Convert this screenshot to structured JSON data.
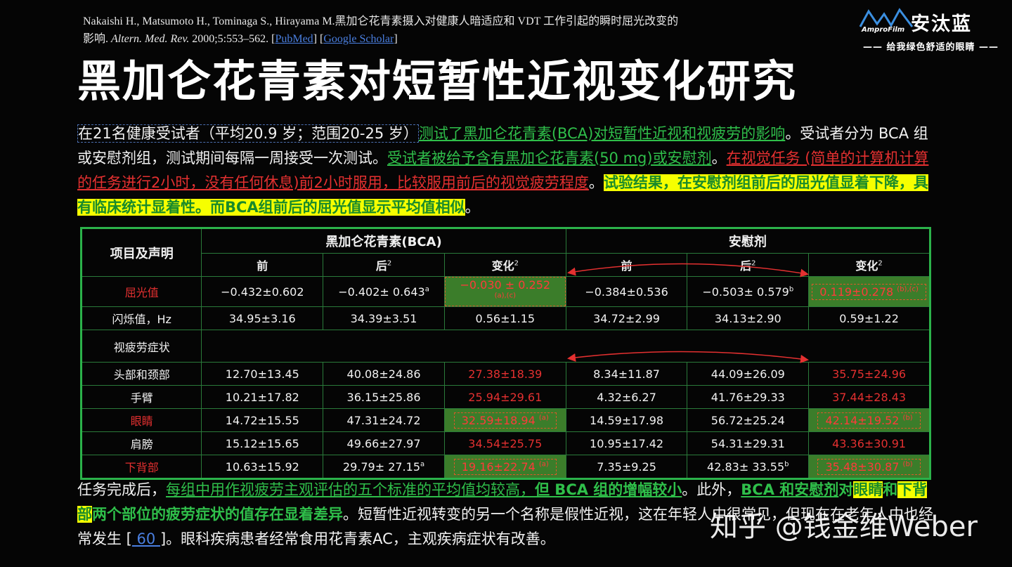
{
  "citation": {
    "line1": "Nakaishi H., Matsumoto H., Tominaga S., Hirayama M.黑加仑花青素摄入对健康人暗适应和 VDT 工作引起的瞬时屈光改变的",
    "line2_pre": "影响. ",
    "journal": "Altern. Med. Rev.",
    "line2_post": " 2000;5:553–562. [",
    "pubmed": "PubMed",
    "mid": "] [",
    "scholar": "Google Scholar",
    "end": "]"
  },
  "logo": {
    "name": "安汰蓝",
    "brand": "AmproFilm",
    "slogan": "—— 给我绿色舒适的眼睛 ——"
  },
  "title": "黑加仑花青素对短暂性近视变化研究",
  "intro": {
    "p1": "在21名健康受试者（平均20.9 岁；范围20-25 岁）",
    "p2": "测试了黑加仑花青素(BCA)对短暂性近视和视疲劳的影响",
    "p3": "。受试者",
    "p4": "分为 BCA 组或安慰剂组，测试期间每隔一周接受一次测试。",
    "p5": "受试者被给予含有黑加仑花青素(50 mg)或安慰剂",
    "p6": "。",
    "p7": "在视觉任务 (简单的计算机计算的任务进行2小时，没有任何休息)前2小时服用，比较服用前后的视觉疲劳程度",
    "p8": "。",
    "p9": "试验结果，在安慰剂组前后的屈光值显着下降，具有临床统计显着性。而BCA组前后的屈光值显示平均值相似",
    "p10": "。"
  },
  "table": {
    "corner": "项目及声明",
    "group1": "黑加仑花青素(BCA)",
    "group2": "安慰剂",
    "sub_before": "前",
    "sub_after": "后",
    "sub_change": "变化",
    "sup2": "2",
    "rows": [
      {
        "label": "屈光值",
        "c1": "−0.432±0.602",
        "c2": "−0.402± 0.643",
        "c2sup": "a",
        "c3": "−0.030 ± 0.252",
        "c3sup": "(a),(c)",
        "c4": "−0.384±0.536",
        "c5": "−0.503± 0.579",
        "c5sup": "b",
        "c6": "0.119±0.278",
        "c6sup": "(b),(c)"
      },
      {
        "label": "闪烁值，Hz",
        "c1": "34.95±3.16",
        "c2": "34.39±3.51",
        "c3": "0.56±1.15",
        "c4": "34.72±2.99",
        "c5": "34.13±2.90",
        "c6": "0.59±1.22"
      },
      {
        "label": "视疲劳症状"
      },
      {
        "label": "头部和颈部",
        "c1": "12.70±13.45",
        "c2": "40.08±24.86",
        "c3": "27.38±18.39",
        "c4": "8.34±11.87",
        "c5": "44.09±26.09",
        "c6": "35.75±24.96"
      },
      {
        "label": "手臂",
        "c1": "10.21±17.82",
        "c2": "36.15±25.86",
        "c3": "25.94±29.61",
        "c4": "4.32±6.27",
        "c5": "41.76±29.33",
        "c6": "37.44±28.43"
      },
      {
        "label": "眼睛",
        "c1": "14.72±15.55",
        "c2": "47.31±24.72",
        "c3": "32.59±18.94",
        "c3sup": "(a)",
        "c4": "14.59±17.98",
        "c5": "56.72±25.24",
        "c6": "42.14±19.52",
        "c6sup": "(b)"
      },
      {
        "label": "肩膀",
        "c1": "15.12±15.65",
        "c2": "49.66±27.97",
        "c3": "34.54±25.75",
        "c4": "10.95±17.42",
        "c5": "54.31±29.31",
        "c6": "43.36±30.91"
      },
      {
        "label": "下背部",
        "c1": "10.63±15.92",
        "c2": "29.79± 27.15",
        "c2sup": "a",
        "c3": "19.16±22.74",
        "c3sup": "(a)",
        "c4": "7.35±9.25",
        "c5": "42.83± 33.55",
        "c5sup": "b",
        "c6": "35.48±30.87",
        "c6sup": "(b)"
      }
    ]
  },
  "summary": {
    "s1": "任务完成后，",
    "s2": "每组中用作视疲劳主观评估的五个标准的平均值均较高，",
    "s3": "但 BCA 组的增幅较小",
    "s4": "。此外，",
    "s5": "BCA 和安慰剂",
    "s6": "对",
    "s7": "眼睛",
    "s8": "和",
    "s9": "下背部",
    "s10": "两个部位的疲劳症状的值存在显着差异",
    "s11": "。短暂性近视转变的另一个名称是假性近视，这在年轻人中很",
    "s12": "常见，但现在在老年人中也经常发生 [",
    "ref": " 60 ",
    "s13": "]。眼科疾病患者经常食用花青素AC，主观疾病症状有改善。"
  },
  "watermark": "知乎 @钱金维Weber",
  "colors": {
    "accent_green": "#2fbf4a",
    "accent_red": "#e43030",
    "highlight": "#f6ff00",
    "table_border": "#2bb24a"
  }
}
